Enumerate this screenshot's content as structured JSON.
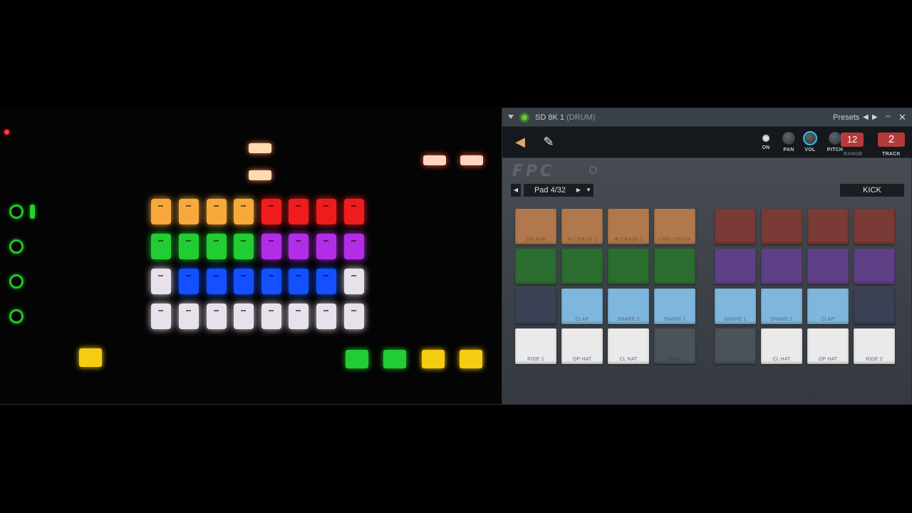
{
  "colors": {
    "orange": "#f7a93b",
    "red": "#ee1c1c",
    "green": "#22cc33",
    "purple": "#b22ee6",
    "blue": "#1450ff",
    "white": "#e8e1ec",
    "yellow": "#f6cc12",
    "ring_green": "#27c22a"
  },
  "controller": {
    "pad_rows": [
      [
        "orange",
        "orange",
        "orange",
        "orange",
        "red",
        "red",
        "red",
        "red"
      ],
      [
        "green",
        "green",
        "green",
        "green",
        "purple",
        "purple",
        "purple",
        "purple"
      ],
      [
        "white",
        "blue",
        "blue",
        "blue",
        "blue",
        "blue",
        "blue",
        "white"
      ],
      [
        "white",
        "white",
        "white",
        "white",
        "white",
        "white",
        "white",
        "white"
      ]
    ],
    "bottom_left_button": "yellow",
    "bottom_right_buttons": [
      "green",
      "green",
      "yellow",
      "yellow"
    ]
  },
  "window": {
    "title": "SD 8K 1",
    "title_sub": "(DRUM)",
    "presets_label": "Presets",
    "prev_icon": "◀",
    "next_icon": "▶",
    "minimize_icon": "▬",
    "close_icon": "✕"
  },
  "toolbar": {
    "knobs": [
      {
        "label": "ON"
      },
      {
        "label": "PAN"
      },
      {
        "label": "VOL"
      },
      {
        "label": "PITCH"
      }
    ],
    "range_value": "12",
    "range_label": "RANGE",
    "track_value": "2",
    "track_label": "TRACK"
  },
  "logo": "FPC",
  "padbar": {
    "prev_icon": "◀",
    "pad_label": "Pad 4/32",
    "next_icon": "▶",
    "dropdown_icon": "▼",
    "sample_name": "KICK"
  },
  "fpc_pads": {
    "left": [
      [
        {
          "label": "SPLASH",
          "color": "#b0784c"
        },
        {
          "label": "HI CRASH 1",
          "color": "#b0784c"
        },
        {
          "label": "HI CRASH 2",
          "color": "#b0784c"
        },
        {
          "label": "CHIN CRASH",
          "color": "#b0784c"
        }
      ],
      [
        {
          "label": "",
          "color": "#2b6e2f"
        },
        {
          "label": "",
          "color": "#2b6e2f"
        },
        {
          "label": "",
          "color": "#2b6e2f"
        },
        {
          "label": "",
          "color": "#2b6e2f"
        }
      ],
      [
        {
          "label": "",
          "color": "#3b4256"
        },
        {
          "label": "CLAP",
          "color": "#7fb6dd"
        },
        {
          "label": "SNARE 2",
          "color": "#7fb6dd"
        },
        {
          "label": "SNARE 1",
          "color": "#7fb6dd"
        }
      ],
      [
        {
          "label": "RIDE 1",
          "color": "#eaeaea"
        },
        {
          "label": "OP HAT",
          "color": "#eaeaea"
        },
        {
          "label": "CL HAT",
          "color": "#eaeaea"
        },
        {
          "label": "KICK",
          "color": "#4a5458"
        }
      ]
    ],
    "right": [
      [
        {
          "label": "",
          "color": "#7a3a35"
        },
        {
          "label": "",
          "color": "#7a3a35"
        },
        {
          "label": "",
          "color": "#7a3a35"
        },
        {
          "label": "",
          "color": "#7a3a35"
        }
      ],
      [
        {
          "label": "",
          "color": "#5f3f86"
        },
        {
          "label": "",
          "color": "#5f3f86"
        },
        {
          "label": "",
          "color": "#5f3f86"
        },
        {
          "label": "",
          "color": "#5f3f86"
        }
      ],
      [
        {
          "label": "SNARE 1",
          "color": "#7fb6dd"
        },
        {
          "label": "SNARE 2",
          "color": "#7fb6dd"
        },
        {
          "label": "CLAP",
          "color": "#7fb6dd"
        },
        {
          "label": "",
          "color": "#3b4256"
        }
      ],
      [
        {
          "label": "",
          "color": "#4a5458"
        },
        {
          "label": "CL HAT",
          "color": "#eaeaea"
        },
        {
          "label": "OP HAT",
          "color": "#eaeaea"
        },
        {
          "label": "RIDE 2",
          "color": "#eaeaea"
        }
      ]
    ]
  }
}
